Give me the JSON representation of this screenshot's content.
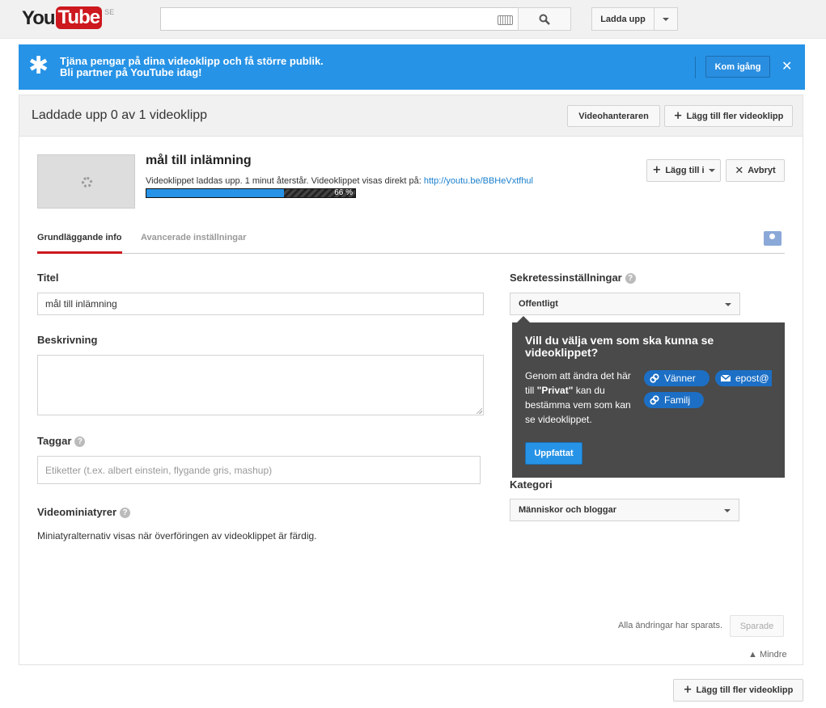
{
  "masthead": {
    "logo_you": "You",
    "logo_tube": "Tube",
    "region": "SE",
    "search_value": "",
    "upload_label": "Ladda upp"
  },
  "partner_banner": {
    "line1": "Tjäna pengar på dina videoklipp och få större publik.",
    "line2": "Bli partner på YouTube idag!",
    "cta_label": "Kom igång",
    "close_glyph": "✕",
    "color": "#2793e6"
  },
  "panel": {
    "title": "Laddade upp 0 av 1 videoklipp",
    "video_manager_label": "Videohanteraren",
    "add_more_label": "Lägg till fler videoklipp"
  },
  "video": {
    "title": "mål till inlämning",
    "status_text": "Videoklippet laddas upp. 1 minut återstår. Videoklippet visas direkt på: ",
    "link": "http://youtu.be/BBHeVxtfhul",
    "progress_percent": 66,
    "progress_label": "66 %",
    "add_to_label": "Lägg till i",
    "cancel_label": "Avbryt"
  },
  "tabs": {
    "basic": "Grundläggande info",
    "advanced": "Avancerade inställningar"
  },
  "form": {
    "title_label": "Titel",
    "title_value": "mål till inlämning",
    "description_label": "Beskrivning",
    "description_value": "",
    "tags_label": "Taggar",
    "tags_placeholder": "Etiketter (t.ex. albert einstein, flygande gris, mashup)",
    "thumbnails_label": "Videominiatyrer",
    "thumbnails_text": "Miniatyralternativ visas när överföringen av videoklippet är färdig.",
    "privacy_label": "Sekretessinställningar",
    "privacy_value": "Offentligt",
    "category_label": "Kategori",
    "category_value": "Människor och bloggar",
    "help_glyph": "?"
  },
  "popover": {
    "title": "Vill du välja vem som ska kunna se videoklippet?",
    "body_pre": "Genom att ändra det här till ",
    "body_bold": "\"Privat\"",
    "body_post": " kan du bestämma vem som kan se videoklippet.",
    "chip_friends": "Vänner",
    "chip_email": "epost@",
    "chip_family": "Familj",
    "ok_label": "Uppfattat"
  },
  "footer": {
    "save_status": "Alla ändringar har sparats.",
    "save_label": "Sparade",
    "less_label": "▲ Mindre",
    "add_more_label": "Lägg till fler videoklipp"
  }
}
